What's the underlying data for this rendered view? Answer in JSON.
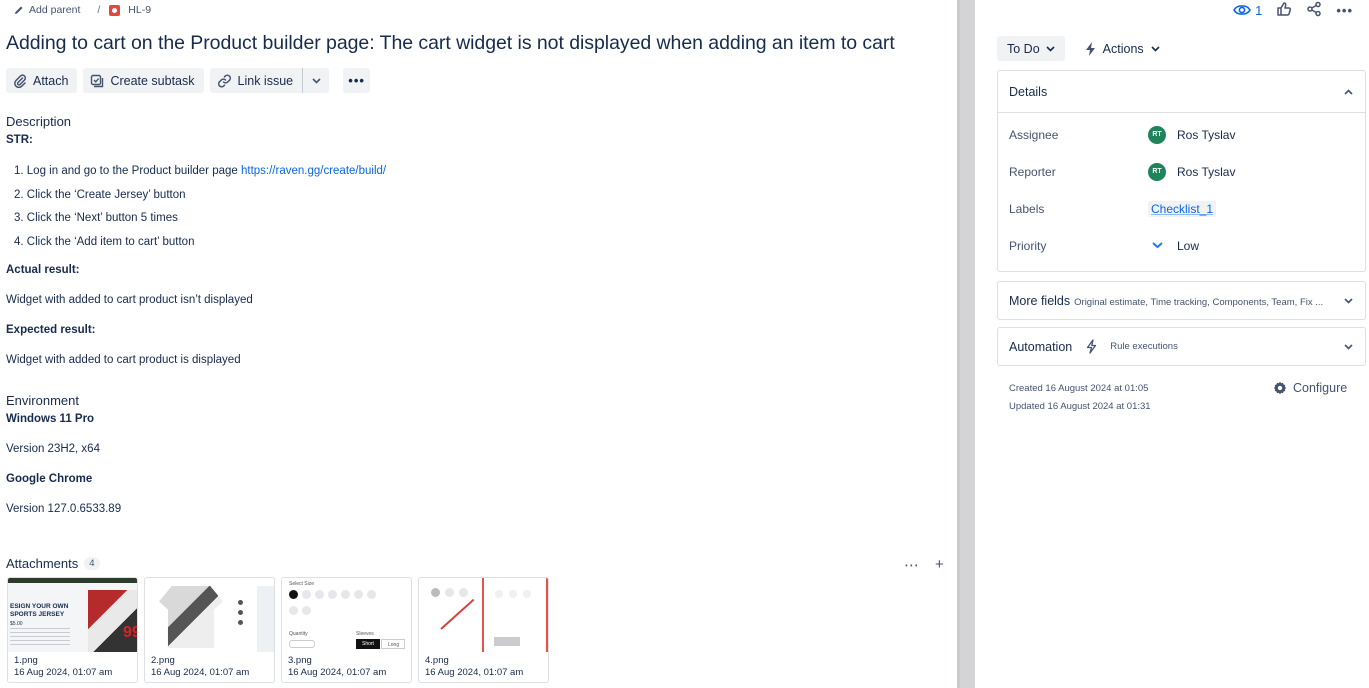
{
  "breadcrumb": {
    "add_parent": "Add parent",
    "separator": "/",
    "issue_key": "HL-9"
  },
  "issue": {
    "title": "Adding to cart on the Product builder page: The cart widget is not displayed when adding an item to cart"
  },
  "toolbar": {
    "attach": "Attach",
    "create_subtask": "Create subtask",
    "link_issue": "Link issue"
  },
  "description": {
    "heading": "Description",
    "str_label": "STR:",
    "steps": [
      {
        "prefix": "1. Log in and go to the Product builder page ",
        "link": "https://raven.gg/create/build/"
      },
      {
        "prefix": "2. Click the ‘Create Jersey’ button"
      },
      {
        "prefix": "3. Click the ‘Next’ button 5 times"
      },
      {
        "prefix": "4. Click the ‘Add item to cart’ button"
      }
    ],
    "actual_label": "Actual result:",
    "actual_text": "Widget with added to cart product isn’t displayed",
    "expected_label": "Expected result:",
    "expected_text": "Widget with added to cart product is displayed"
  },
  "environment": {
    "heading": "Environment",
    "os": "Windows 11 Pro",
    "os_version": "Version 23H2, x64",
    "browser": "Google Chrome",
    "browser_version": "Version 127.0.6533.89"
  },
  "attachments": {
    "heading": "Attachments",
    "count": "4",
    "items": [
      {
        "name": "1.png",
        "date": "16 Aug 2024, 01:07 am",
        "preview_text": "ESIGN YOUR OWN\nSPORTS JERSEY",
        "preview_price": "$5.00",
        "preview_number": "99"
      },
      {
        "name": "2.png",
        "date": "16 Aug 2024, 01:07 am"
      },
      {
        "name": "3.png",
        "date": "16 Aug 2024, 01:07 am",
        "preview_size_label": "Select Size",
        "preview_qty_label": "Quantity",
        "preview_sleeve_label": "Sleeves",
        "preview_short": "Short",
        "preview_long": "Long"
      },
      {
        "name": "4.png",
        "date": "16 Aug 2024, 01:07 am"
      }
    ]
  },
  "side": {
    "watchers": "1",
    "status": "To Do",
    "actions": "Actions",
    "details": {
      "heading": "Details",
      "assignee_label": "Assignee",
      "assignee": "Ros Tyslav",
      "assignee_initials": "RT",
      "reporter_label": "Reporter",
      "reporter": "Ros Tyslav",
      "reporter_initials": "RT",
      "labels_label": "Labels",
      "labels_value": "Checklist_1",
      "priority_label": "Priority",
      "priority_value": "Low"
    },
    "more_fields": {
      "heading": "More fields",
      "hint": "Original estimate, Time tracking, Components, Team, Fix ..."
    },
    "automation": {
      "heading": "Automation",
      "hint": "Rule executions"
    },
    "created": "Created 16 August 2024 at 01:05",
    "updated": "Updated 16 August 2024 at 01:31",
    "configure": "Configure"
  },
  "colors": {
    "link": "#0c66e4",
    "bug": "#e2483d",
    "avatar": "#1f845a",
    "text": "#172b4d"
  }
}
